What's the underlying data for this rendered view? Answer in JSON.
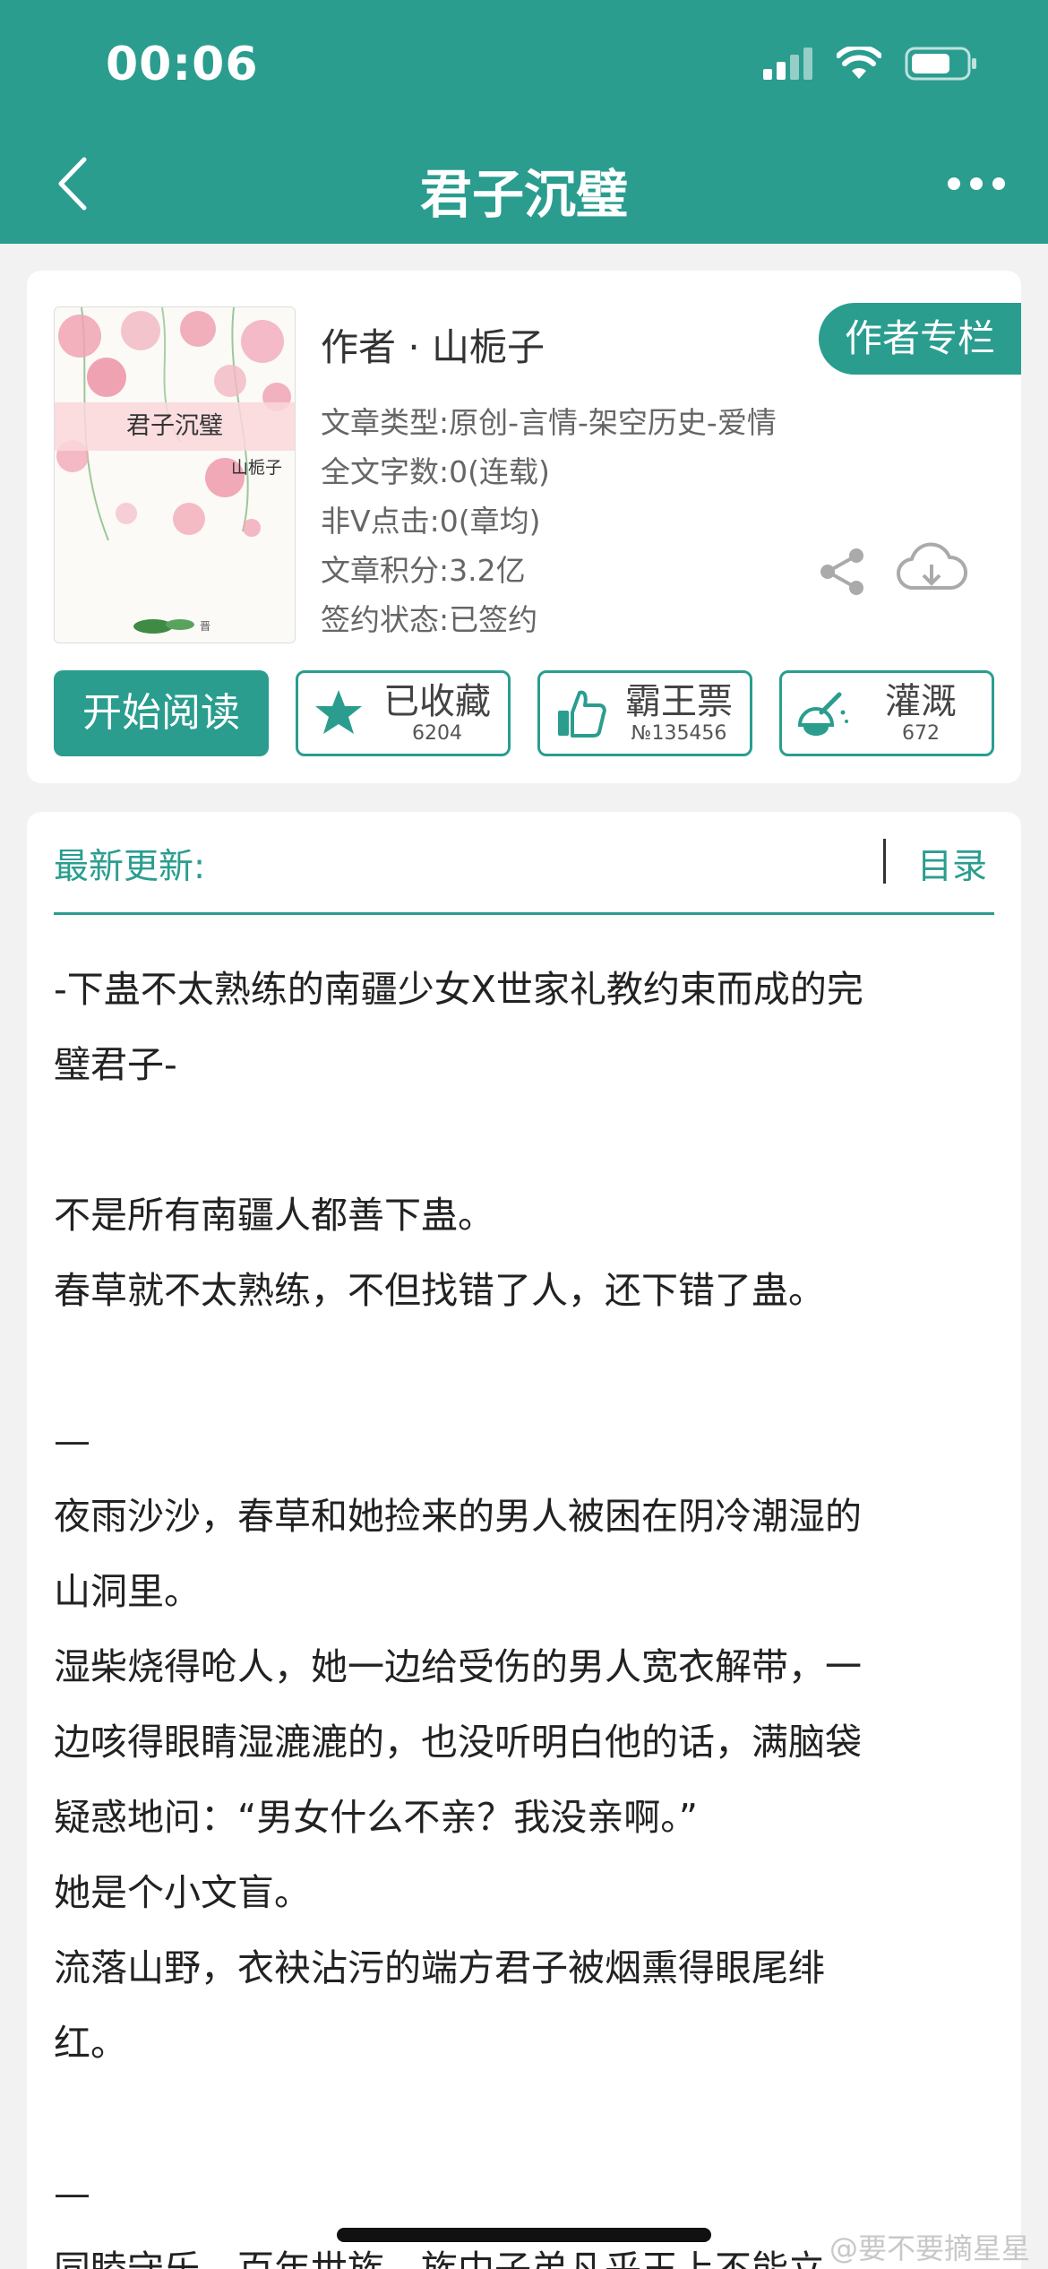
{
  "status_bar": {
    "time": "00:06"
  },
  "nav": {
    "title": "君子沉璧"
  },
  "book": {
    "cover_title": "君子沉璧",
    "cover_author": "山栀子",
    "author": "作者 · 山栀子",
    "author_column_label": "作者专栏",
    "meta": [
      "文章类型:原创-言情-架空历史-爱情",
      "全文字数:0(连载)",
      "非V点击:0(章均)",
      "文章积分:3.2亿",
      "签约状态:已签约"
    ]
  },
  "actions": {
    "read_label": "开始阅读",
    "collect_label": "已收藏",
    "collect_count": "6204",
    "vote_label": "霸王票",
    "vote_rank": "№135456",
    "nutrient_label": "灌溉",
    "nutrient_count": "672"
  },
  "latest": {
    "label": "最新更新:",
    "toc_label": "目录"
  },
  "content_paragraphs": [
    "-下蛊不太熟练的南疆少女X世家礼教约束而成的完",
    "璧君子-",
    "",
    "不是所有南疆人都善下蛊。",
    "春草就不太熟练，不但找错了人，还下错了蛊。",
    "",
    "—",
    "夜雨沙沙，春草和她捡来的男人被困在阴冷潮湿的",
    "山洞里。",
    "湿柴烧得呛人，她一边给受伤的男人宽衣解带，一",
    "边咳得眼睛湿漉漉的，也没听明白他的话，满脑袋",
    "疑惑地问：“男女什么不亲？我没亲啊。”",
    "她是个小文盲。",
    "流落山野，衣袂沾污的端方君子被烟熏得眼尾绯",
    "红。",
    "",
    "—",
    "同睦守乐，百年世族，族中子弟凡乎王上不能立"
  ],
  "watermark": "@要不要摘星星",
  "colors": {
    "accent": "#2a9d8f"
  }
}
